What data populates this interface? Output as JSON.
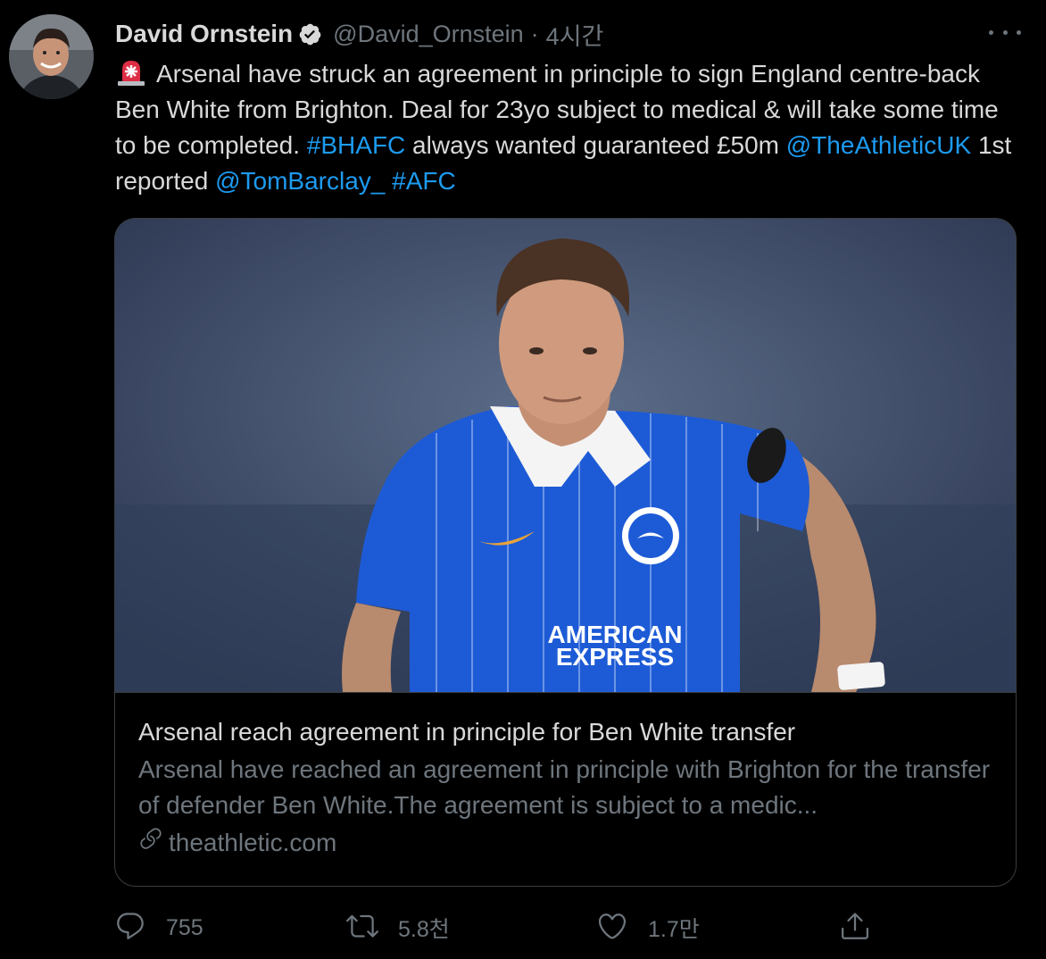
{
  "author": {
    "display_name": "David Ornstein",
    "handle": "@David_Ornstein",
    "separator": "·",
    "time": "4시간"
  },
  "tweet": {
    "text_parts": [
      {
        "text": "Arsenal have struck an agreement in principle to sign England centre-back Ben White from Brighton. Deal for 23yo subject to medical & will take some time to be completed. ",
        "type": "text"
      },
      {
        "text": "#BHAFC",
        "type": "link"
      },
      {
        "text": " always wanted guaranteed £50m ",
        "type": "text"
      },
      {
        "text": "@TheAthleticUK",
        "type": "link"
      },
      {
        "text": " 1st reported ",
        "type": "text"
      },
      {
        "text": "@TomBarclay_",
        "type": "link"
      },
      {
        "text": " ",
        "type": "text"
      },
      {
        "text": "#AFC",
        "type": "link"
      }
    ]
  },
  "card": {
    "title": "Arsenal reach agreement in principle for Ben White transfer",
    "description": "Arsenal have reached an agreement in principle with Brighton for the transfer of defender Ben White.The agreement is subject to a medic...",
    "domain": "theathletic.com",
    "image_text": {
      "sponsor_line1": "AMERICAN",
      "sponsor_line2": "EXPRESS"
    }
  },
  "actions": {
    "reply_count": "755",
    "retweet_count": "5.8천",
    "like_count": "1.7만"
  },
  "icons": [
    "verified-badge-icon",
    "more-icon",
    "police-light-icon",
    "link-icon",
    "reply-icon",
    "retweet-icon",
    "like-icon",
    "share-icon"
  ],
  "colors": {
    "background": "#000000",
    "text": "#d9d9d9",
    "muted": "#6e767d",
    "link": "#1d9bf0",
    "border": "#3a3d41"
  }
}
